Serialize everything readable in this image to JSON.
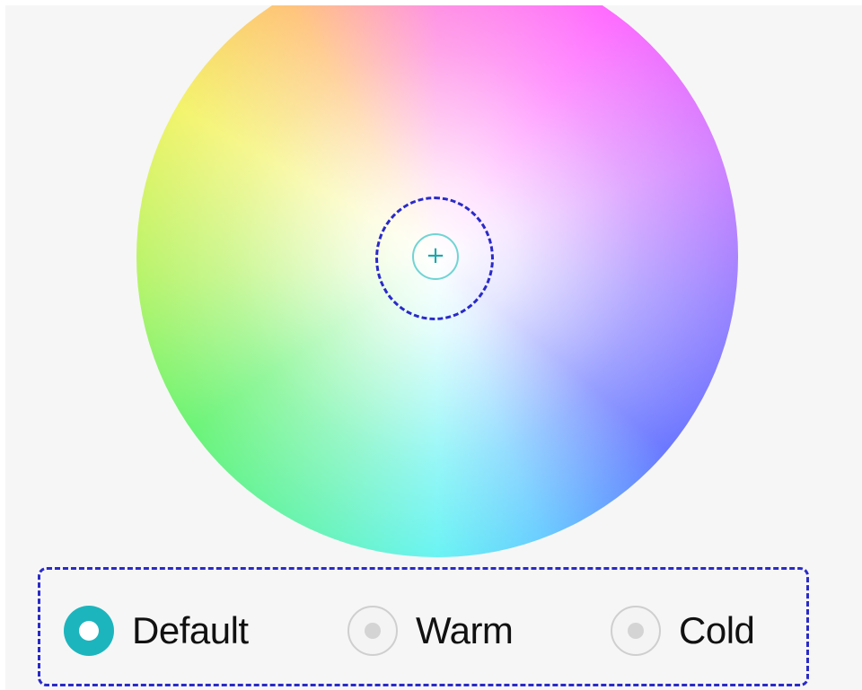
{
  "color_wheel": {
    "selector_icon": "+",
    "accent_color": "#1db5bd",
    "highlight_color": "#2a2ac8"
  },
  "mode": {
    "options": [
      {
        "label": "Default",
        "selected": true
      },
      {
        "label": "Warm",
        "selected": false
      },
      {
        "label": "Cold",
        "selected": false
      }
    ]
  }
}
